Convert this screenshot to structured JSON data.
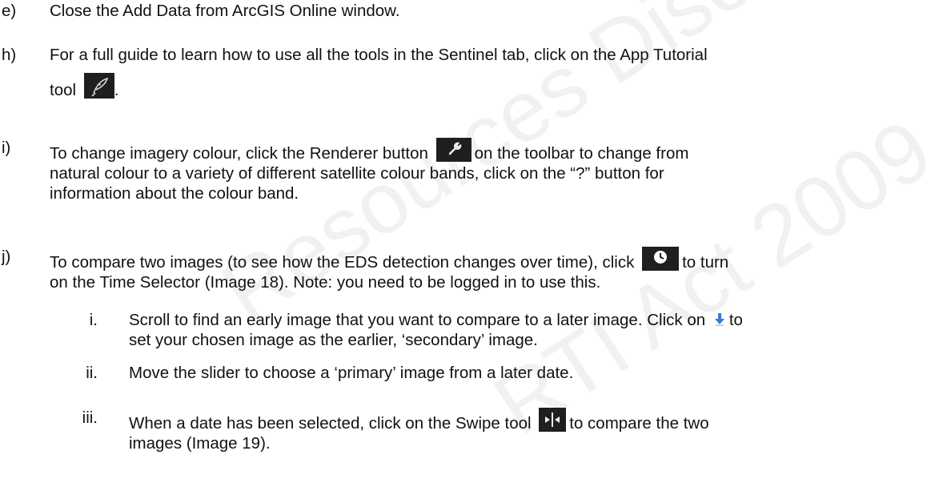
{
  "watermark": {
    "line1": "Resources Disclosure Log",
    "line2": "RTI Act 2009"
  },
  "items": {
    "e": {
      "marker": "e)",
      "text": "Close the Add Data from ArcGIS Online window."
    },
    "h": {
      "marker": "h)",
      "line1": "For a full guide to learn how to use all the tools in the Sentinel tab, click on the App Tutorial",
      "line2_pre": "tool",
      "line2_post": "."
    },
    "i": {
      "marker": "i)",
      "line1_pre": "To change imagery colour, click the Renderer button",
      "line1_post": "on the toolbar to change from",
      "line2": "natural colour to a variety of different satellite colour bands, click on the “?” button for",
      "line3": "information about the colour band."
    },
    "j": {
      "marker": "j)",
      "line1_pre": "To compare two images (to see how the EDS detection changes over time), click",
      "line1_post": "to turn",
      "line2": "on the Time Selector (Image 18). Note: you need to be logged in to use this."
    },
    "j_i": {
      "marker": "i.",
      "line1_pre": "Scroll to find an early image that you want to compare to a later image. Click on",
      "line1_post": "to",
      "line2": "set your chosen image as the earlier, ‘secondary’ image."
    },
    "j_ii": {
      "marker": "ii.",
      "text": "Move the slider to choose a ‘primary’ image from a later date."
    },
    "j_iii": {
      "marker": "iii.",
      "line1_pre": "When a date has been selected, click on the Swipe tool",
      "line1_post": "to compare the two",
      "line2": "images (Image 19)."
    }
  },
  "icons": {
    "app_tutorial": "feather-icon",
    "renderer": "wrench-icon",
    "time_selector": "clock-icon",
    "set_secondary": "download-arrow-icon",
    "swipe": "swipe-icon"
  },
  "colors": {
    "icon_bg": "#1f1f1f",
    "arrow_blue": "#2f7fd8",
    "text": "#111111"
  }
}
